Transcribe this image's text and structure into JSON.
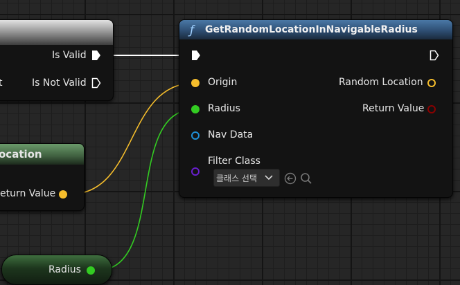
{
  "nodes": {
    "is_valid": {
      "pin_is_valid": "Is Valid",
      "pin_is_not_valid": "Is Not Valid",
      "pin_partial": "t"
    },
    "get_location": {
      "title_partial": "ocation",
      "pin_return_value": "eturn Value"
    },
    "radius_var": {
      "label": "Radius"
    },
    "main": {
      "function_glyph": "ƒ",
      "title": "GetRandomLocationInNavigableRadius",
      "inputs": {
        "origin": "Origin",
        "radius": "Radius",
        "nav_data": "Nav Data",
        "filter_class": "Filter Class"
      },
      "outputs": {
        "random_location": "Random Location",
        "return_value": "Return Value"
      },
      "class_dropdown": {
        "selected": "클래스 선택"
      }
    }
  },
  "colors": {
    "vector_pin": "#f5bd2c",
    "float_pin": "#33cc22",
    "bool_pin": "#8b0000",
    "object_pin": "#1e90d8",
    "class_pin": "#6a1fd0",
    "exec_wire": "#ffffff"
  },
  "icons": [
    "function-icon",
    "exec-pin-icon",
    "chevron-down-icon",
    "use-selected-asset-icon",
    "browse-icon"
  ]
}
